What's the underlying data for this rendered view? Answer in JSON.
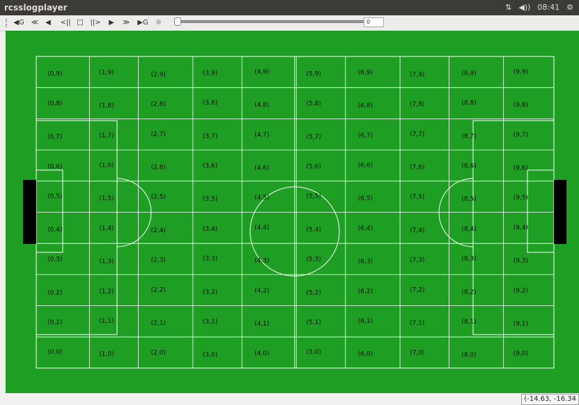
{
  "window": {
    "title": "rcsslogplayer"
  },
  "tray": {
    "network_icon": "network-arrows-icon",
    "volume_icon": "volume-icon",
    "volume_text": "◀))",
    "time": "08:41",
    "power_icon": "gear-icon"
  },
  "toolbar": {
    "buttons": [
      {
        "name": "goto-start-button",
        "glyph": "◀G"
      },
      {
        "name": "rewind-fast-button",
        "glyph": "≪"
      },
      {
        "name": "step-back-button",
        "glyph": "◀"
      },
      {
        "name": "play-back-button",
        "glyph": "<||"
      },
      {
        "name": "stop-button",
        "glyph": "□"
      },
      {
        "name": "step-forward-button",
        "glyph": "||>"
      },
      {
        "name": "play-button",
        "glyph": "▶"
      },
      {
        "name": "fast-forward-button",
        "glyph": "≫"
      },
      {
        "name": "goto-end-button",
        "glyph": "▶G"
      }
    ],
    "spin_value": "0"
  },
  "field": {
    "grid_labels": [
      [
        "(0,0)",
        "(1,0)",
        "(2,0)",
        "(3,0)",
        "(4,0)",
        "(5,0)",
        "(6,0)",
        "(7,0)",
        "(8,0)",
        "(9,0)"
      ],
      [
        "(0,1)",
        "(1,1)",
        "(2,1)",
        "(3,1)",
        "(4,1)",
        "(5,1)",
        "(6,1)",
        "(7,1)",
        "(8,1)",
        "(9,1)"
      ],
      [
        "(0,2)",
        "(1,2)",
        "(2,2)",
        "(3,2)",
        "(4,2)",
        "(5,2)",
        "(6,2)",
        "(7,2)",
        "(8,2)",
        "(9,2)"
      ],
      [
        "(0,3)",
        "(1,3)",
        "(2,3)",
        "(3,3)",
        "(4,3)",
        "(5,3)",
        "(6,3)",
        "(7,3)",
        "(8,3)",
        "(9,3)"
      ],
      [
        "(0,4)",
        "(1,4)",
        "(2,4)",
        "(3,4)",
        "(4,4)",
        "(5,4)",
        "(6,4)",
        "(7,4)",
        "(8,4)",
        "(9,4)"
      ],
      [
        "(0,5)",
        "(1,5)",
        "(2,5)",
        "(3,5)",
        "(4,5)",
        "(5,5)",
        "(6,5)",
        "(7,5)",
        "(8,5)",
        "(9,5)"
      ],
      [
        "(0,6)",
        "(1,6)",
        "(2,6)",
        "(3,6)",
        "(4,6)",
        "(5,6)",
        "(6,6)",
        "(7,6)",
        "(8,6)",
        "(9,6)"
      ],
      [
        "(0,7)",
        "(1,7)",
        "(2,7)",
        "(3,7)",
        "(4,7)",
        "(5,7)",
        "(6,7)",
        "(7,7)",
        "(8,7)",
        "(9,7)"
      ],
      [
        "(0,8)",
        "(1,8)",
        "(2,8)",
        "(3,8)",
        "(4,8)",
        "(5,8)",
        "(6,8)",
        "(7,8)",
        "(8,8)",
        "(9,8)"
      ],
      [
        "(0,9)",
        "(1,9)",
        "(2,9)",
        "(3,9)",
        "(4,9)",
        "(5,9)",
        "(6,9)",
        "(7,9)",
        "(8,9)",
        "(9,9)"
      ]
    ],
    "colors": {
      "grass": "#1f9e24",
      "lines": "#ffffff",
      "goal": "#000000"
    }
  },
  "status": {
    "cursor_coords": "(-14.63, -16.34"
  }
}
